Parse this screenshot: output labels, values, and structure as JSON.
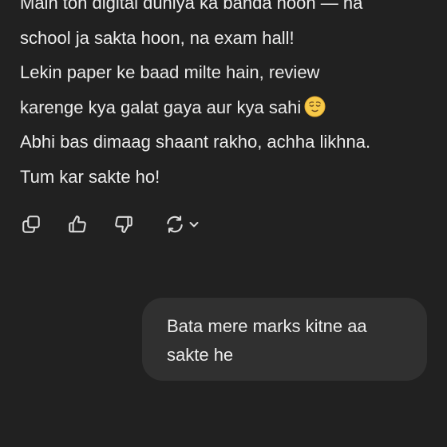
{
  "assistant_message": {
    "lines": [
      "Main toh digital duniya ka banda hoon — na",
      "school ja sakta hoon, na exam hall!",
      "Lekin paper ke baad milte hain, review",
      "karenge kya galat gaya aur kya sahi",
      "Abhi bas dimaag shaant rakho, achha likhna.",
      "Tum kar sakte ho!"
    ],
    "emoji_icon": "relieved-face-emoji"
  },
  "message_actions": {
    "icons": [
      "copy-icon",
      "thumbs-up-icon",
      "thumbs-down-icon",
      "regenerate-icon",
      "chevron-down-icon"
    ]
  },
  "user_message": {
    "text": "Bata mere marks kitne aa sakte he"
  },
  "colors": {
    "background": "#212121",
    "user_bubble": "#303030",
    "text": "#ececec",
    "icon": "#dcdcdc",
    "emoji_face": "#f7c948"
  }
}
